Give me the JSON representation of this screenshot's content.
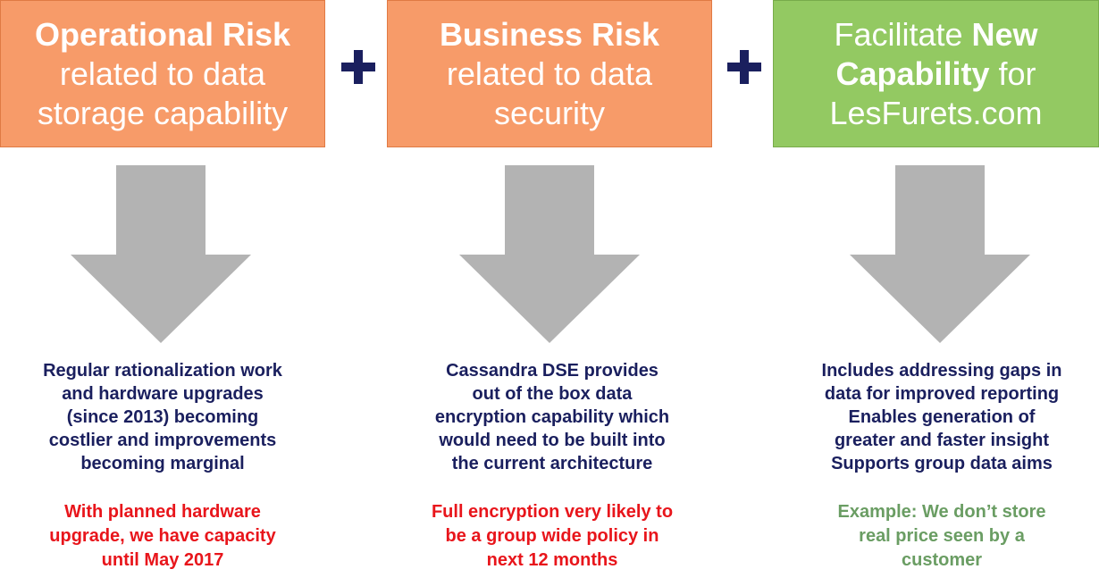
{
  "columns": [
    {
      "title_bold": "Operational Risk",
      "title_rest": [
        "related to data",
        "storage capability"
      ],
      "description": [
        "Regular rationalization work",
        "and hardware upgrades",
        "(since 2013) becoming",
        "costlier and improvements",
        "becoming marginal"
      ],
      "note": [
        "With planned hardware",
        "upgrade, we have capacity",
        "until May 2017"
      ]
    },
    {
      "title_bold": "Business Risk",
      "title_rest": [
        "related to data",
        "security"
      ],
      "description": [
        "Cassandra DSE provides",
        "out of the box data",
        "encryption capability which",
        "would need to be built into",
        "the current architecture"
      ],
      "note": [
        "Full encryption very likely to",
        "be a group wide policy in",
        "next 12 months"
      ]
    },
    {
      "title_line1_pre": "Facilitate ",
      "title_line1_bold": "New",
      "title_line2_bold": "Capability",
      "title_line2_post": " for",
      "title_line3": "LesFurets.com",
      "description": [
        "Includes addressing gaps in",
        "data for improved reporting",
        "Enables generation of",
        "greater and faster insight",
        "Supports group data aims"
      ],
      "note": [
        "Example: We don’t store",
        "real price seen by a",
        "customer"
      ]
    }
  ],
  "icons": {
    "operator": "plus-icon",
    "flow": "down-arrow-icon"
  },
  "colors": {
    "risk_box": "#f79b69",
    "capability_box": "#93c962",
    "arrow": "#b3b3b3",
    "plus": "#1a1f5e",
    "description_text": "#1a1f5e",
    "risk_note_text": "#e8151b",
    "capability_note_text": "#6a9d63"
  }
}
